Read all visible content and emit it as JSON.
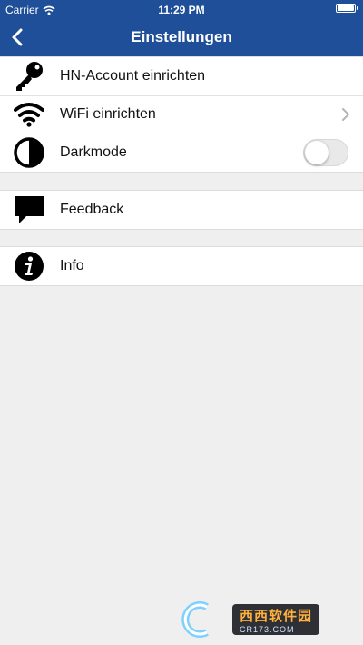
{
  "status_bar": {
    "carrier": "Carrier",
    "time": "11:29 PM"
  },
  "nav": {
    "title": "Einstellungen",
    "back_icon": "chevron-left-icon"
  },
  "groups": [
    {
      "rows": [
        {
          "label": "HN-Account einrichten",
          "icon": "key-icon"
        },
        {
          "label": "WiFi einrichten",
          "icon": "wifi-icon",
          "accessory": "chevron-right-icon"
        },
        {
          "label": "Darkmode",
          "icon": "half-circle-icon",
          "accessory": "toggle",
          "toggle_on": false
        }
      ]
    },
    {
      "rows": [
        {
          "label": "Feedback",
          "icon": "speech-bubble-icon"
        }
      ]
    },
    {
      "rows": [
        {
          "label": "Info",
          "icon": "info-icon"
        }
      ]
    }
  ],
  "colors": {
    "header": "#1f4f99",
    "background": "#efeff0",
    "row": "#ffffff"
  },
  "watermark": {
    "main": "西西软件园",
    "sub": "CR173.COM"
  }
}
